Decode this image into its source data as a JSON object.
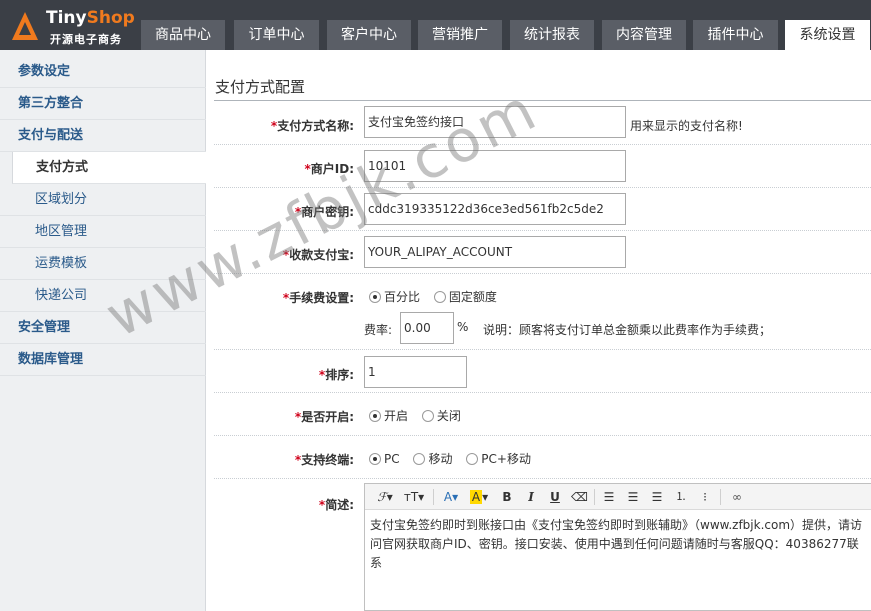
{
  "brand": {
    "name_a": "Tiny",
    "name_b": "Shop",
    "subtitle": "开源电子商务",
    "accent": "#f07a1e"
  },
  "top_tabs": [
    "商品中心",
    "订单中心",
    "客户中心",
    "营销推广",
    "统计报表",
    "内容管理",
    "插件中心",
    "系统设置"
  ],
  "active_tab": "系统设置",
  "sidebar": {
    "items": [
      {
        "label": "参数设定",
        "type": "group"
      },
      {
        "label": "第三方整合",
        "type": "group"
      },
      {
        "label": "支付与配送",
        "type": "group"
      },
      {
        "label": "支付方式",
        "type": "sub",
        "active": true
      },
      {
        "label": "区域划分",
        "type": "sub"
      },
      {
        "label": "地区管理",
        "type": "sub"
      },
      {
        "label": "运费模板",
        "type": "sub"
      },
      {
        "label": "快递公司",
        "type": "sub"
      },
      {
        "label": "安全管理",
        "type": "group"
      },
      {
        "label": "数据库管理",
        "type": "group"
      }
    ]
  },
  "page_title": "支付方式配置",
  "form": {
    "name_label": "支付方式名称:",
    "name_value": "支付宝免签约接口",
    "name_hint": "用来显示的支付名称!",
    "partner_label": "商户ID:",
    "partner_value": "10101",
    "key_label": "商户密钥:",
    "key_value": "cddc319335122d36ce3ed561fb2c5de2",
    "account_label": "收款支付宝:",
    "account_value": "YOUR_ALIPAY_ACCOUNT",
    "fee_label": "手续费设置:",
    "fee_options": [
      "百分比",
      "固定额度"
    ],
    "fee_rate_label": "费率:",
    "fee_rate_value": "0.00",
    "fee_rate_unit": "%",
    "fee_rate_hint": "说明：顾客将支付订单总金额乘以此费率作为手续费；",
    "sort_label": "排序:",
    "sort_value": "1",
    "enable_label": "是否开启:",
    "enable_options": [
      "开启",
      "关闭"
    ],
    "terminal_label": "支持终端:",
    "terminal_options": [
      "PC",
      "移动",
      "PC+移动"
    ],
    "desc_label": "简述:",
    "desc_text": "支付宝免签约即时到账接口由《支付宝免签约即时到账辅助》（www.zfbjk.com）提供，请访问官网获取商户ID、密钥。接口安装、使用中遇到任何问题请随时与客服QQ：40386277联系"
  },
  "editor_toolbar": [
    "font-family-icon",
    "font-size-icon",
    "font-color-icon",
    "highlight-icon",
    "bold-icon",
    "italic-icon",
    "underline-icon",
    "eraser-icon",
    "align-left-icon",
    "align-center-icon",
    "align-right-icon",
    "ordered-list-icon",
    "unordered-list-icon",
    "link-icon"
  ],
  "watermark": "www.zfbjk.com",
  "required_mark": "*"
}
